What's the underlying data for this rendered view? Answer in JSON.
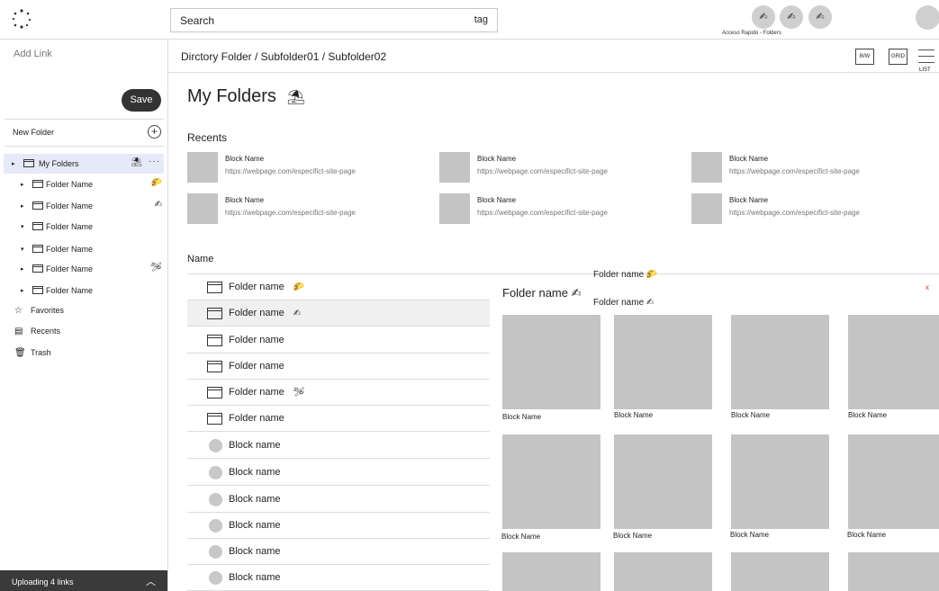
{
  "search": {
    "placeholder": "Search",
    "tag": "tag"
  },
  "quick_access": {
    "label": "Acceso Rapido -  Folders",
    "icons": [
      "pencil-icon",
      "pencil-icon",
      "pencil-icon"
    ]
  },
  "sidebar": {
    "add_link": "Add Link",
    "save": "Save",
    "new_folder": "New Folder",
    "tree": [
      {
        "label": "My Folders",
        "tri": "▸",
        "icon": "⛱",
        "more": "···",
        "selected": true
      },
      {
        "label": "Folder Name",
        "tri": "▸",
        "icon": "🌮"
      },
      {
        "label": "Folder Name",
        "tri": "▸",
        "icon": "✍"
      },
      {
        "label": "Folder Name",
        "tri": "▾",
        "icon": ""
      },
      {
        "label": "Folder Name",
        "tri": "▾",
        "icon": ""
      },
      {
        "label": "Folder Name",
        "tri": "▸",
        "icon": "🛩"
      },
      {
        "label": "Folder Name",
        "tri": "▸",
        "icon": ""
      }
    ],
    "nav": [
      {
        "label": "Favorites",
        "icon": "☆"
      },
      {
        "label": "Recents",
        "icon": "▤"
      },
      {
        "label": "Trash",
        "icon": "🗑"
      }
    ],
    "upload": "Uploading 4 links"
  },
  "breadcrumb": "Dirctory Folder / Subfolder01 / Subfolder02",
  "toolbar": {
    "bw": "B/W",
    "grid": "GRID",
    "list": "LIST"
  },
  "main": {
    "title": "My Folders",
    "title_icon": "⛱",
    "recents_heading": "Recents",
    "recents": [
      {
        "name": "Block Name",
        "url": "https://webpage.com/especifict-site-page"
      },
      {
        "name": "Block Name",
        "url": "https://webpage.com/especifict-site-page"
      },
      {
        "name": "Block Name",
        "url": "https://webpage.com/especifict-site-page"
      },
      {
        "name": "Block Name",
        "url": "https://webpage.com/especifict-site-page"
      },
      {
        "name": "Block Name",
        "url": "https://webpage.com/especifict-site-page"
      },
      {
        "name": "Block Name",
        "url": "https://webpage.com/especifict-site-page"
      }
    ],
    "name_heading": "Name",
    "list": [
      {
        "type": "folder",
        "label": "Folder name",
        "icon": "🌮"
      },
      {
        "type": "folder",
        "label": "Folder name",
        "icon": "✍",
        "highlight": true
      },
      {
        "type": "folder",
        "label": "Folder name",
        "icon": ""
      },
      {
        "type": "folder",
        "label": "Folder name",
        "icon": ""
      },
      {
        "type": "folder",
        "label": "Folder name",
        "icon": "🛩"
      },
      {
        "type": "folder",
        "label": "Folder name",
        "icon": ""
      },
      {
        "type": "block",
        "label": "Block name"
      },
      {
        "type": "block",
        "label": "Block name"
      },
      {
        "type": "block",
        "label": "Block name"
      },
      {
        "type": "block",
        "label": "Block name"
      },
      {
        "type": "block",
        "label": "Block name"
      },
      {
        "type": "block",
        "label": "Block name"
      }
    ]
  },
  "panel": {
    "title": "Folder name ✍",
    "drag_label_1": "Folder name  🌮",
    "drag_label_2": "Folder name  ✍",
    "close": "x",
    "cards": [
      "Block Name",
      "Block Name",
      "Block Name",
      "Block Name",
      "Block Name",
      "Block Name",
      "Block Name",
      "Block Name"
    ]
  }
}
